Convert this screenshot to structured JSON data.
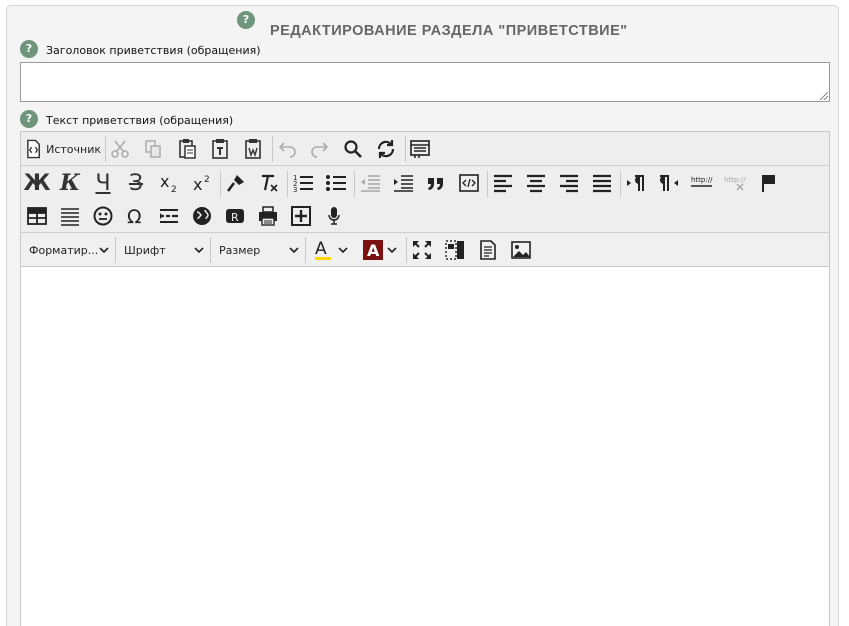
{
  "page": {
    "title": "РЕДАКТИРОВАНИЕ РАЗДЕЛА \"ПРИВЕТСТВИЕ\"",
    "help_glyph": "?"
  },
  "fields": {
    "heading_label": "Заголовок приветствия (обращения)",
    "heading_value": "",
    "text_label": "Текст приветствия (обращения)"
  },
  "toolbar": {
    "source_label": "Источник",
    "format_select": "Форматир...",
    "font_select": "Шрифт",
    "size_select": "Размер",
    "bold_glyph": "Ж",
    "italic_glyph": "К",
    "underline_glyph": "Ч",
    "strike_glyph": "З",
    "text_color": "#ffd700",
    "bg_color_box": "#7a1010"
  },
  "editor": {
    "content": ""
  }
}
